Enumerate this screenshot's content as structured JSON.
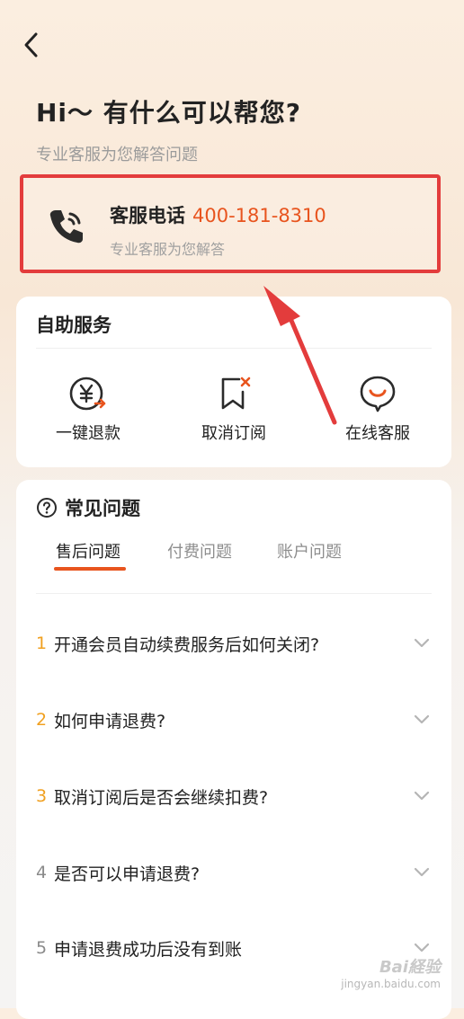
{
  "header": {
    "back_icon": "chevron-left-icon",
    "greeting": "Hi～ 有什么可以帮您?",
    "subtitle": "专业客服为您解答问题"
  },
  "phone_card": {
    "label": "客服电话",
    "number": "400-181-8310",
    "description": "专业客服为您解答",
    "icon": "phone-icon",
    "highlight_color": "#e33c3c"
  },
  "self_service": {
    "title": "自助服务",
    "items": [
      {
        "label": "一键退款",
        "icon": "yen-refund-icon"
      },
      {
        "label": "取消订阅",
        "icon": "bookmark-cancel-icon"
      },
      {
        "label": "在线客服",
        "icon": "chat-smile-icon"
      }
    ]
  },
  "faq": {
    "title": "常见问题",
    "icon": "question-circle-icon",
    "tabs": [
      {
        "label": "售后问题",
        "active": true
      },
      {
        "label": "付费问题",
        "active": false
      },
      {
        "label": "账户问题",
        "active": false
      }
    ],
    "items": [
      {
        "num": "1",
        "text": "开通会员自动续费服务后如何关闭?"
      },
      {
        "num": "2",
        "text": "如何申请退费?"
      },
      {
        "num": "3",
        "text": "取消订阅后是否会继续扣费?"
      },
      {
        "num": "4",
        "text": "是否可以申请退费?"
      },
      {
        "num": "5",
        "text": "申请退费成功后没有到账"
      }
    ]
  },
  "watermark": {
    "brand": "Bai経验",
    "url": "jingyan.baidu.com"
  },
  "colors": {
    "accent": "#e8541e",
    "hot_number": "#f0a020",
    "annotation_red": "#e33c3c"
  }
}
